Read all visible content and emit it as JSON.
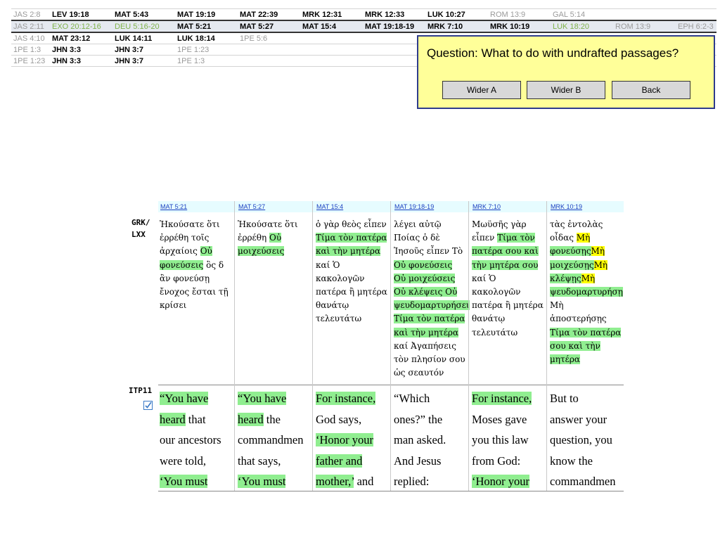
{
  "passages": {
    "rows": [
      {
        "selected": false,
        "cells": [
          {
            "text": "JAS 2:8",
            "style": "grey"
          },
          {
            "text": "LEV 19:18",
            "style": "bold"
          },
          {
            "text": "MAT 5:43",
            "style": "bold"
          },
          {
            "text": "MAT 19:19",
            "style": "bold"
          },
          {
            "text": "MAT 22:39",
            "style": "bold"
          },
          {
            "text": "MRK 12:31",
            "style": "bold"
          },
          {
            "text": "MRK 12:33",
            "style": "bold"
          },
          {
            "text": "LUK 10:27",
            "style": "bold"
          },
          {
            "text": "ROM 13:9",
            "style": "grey"
          },
          {
            "text": "GAL 5:14",
            "style": "grey"
          },
          {
            "text": "",
            "style": "grey"
          },
          {
            "text": "",
            "style": "grey"
          }
        ]
      },
      {
        "selected": true,
        "cells": [
          {
            "text": "JAS 2:11",
            "style": "grey"
          },
          {
            "text": "EXO 20:12-16",
            "style": "green"
          },
          {
            "text": "DEU 5:16-20",
            "style": "green"
          },
          {
            "text": "MAT 5:21",
            "style": "bold"
          },
          {
            "text": "MAT 5:27",
            "style": "bold"
          },
          {
            "text": "MAT 15:4",
            "style": "bold"
          },
          {
            "text": "MAT 19:18-19",
            "style": "bold"
          },
          {
            "text": "MRK 7:10",
            "style": "bold"
          },
          {
            "text": "MRK 10:19",
            "style": "bold"
          },
          {
            "text": "LUK 18:20",
            "style": "green"
          },
          {
            "text": "ROM 13:9",
            "style": "grey"
          },
          {
            "text": "EPH 6:2-3",
            "style": "grey"
          }
        ]
      },
      {
        "selected": false,
        "cells": [
          {
            "text": "JAS 4:10",
            "style": "grey"
          },
          {
            "text": "MAT 23:12",
            "style": "bold"
          },
          {
            "text": "LUK 14:11",
            "style": "bold"
          },
          {
            "text": "LUK 18:14",
            "style": "bold"
          },
          {
            "text": "1PE 5:6",
            "style": "grey"
          },
          {
            "text": "",
            "style": "grey"
          },
          {
            "text": "",
            "style": "grey"
          },
          {
            "text": "",
            "style": "grey"
          },
          {
            "text": "",
            "style": "grey"
          },
          {
            "text": "",
            "style": "grey"
          },
          {
            "text": "",
            "style": "grey"
          },
          {
            "text": "",
            "style": "grey"
          }
        ]
      },
      {
        "selected": false,
        "cells": [
          {
            "text": "1PE 1:3",
            "style": "grey"
          },
          {
            "text": "JHN 3:3",
            "style": "bold"
          },
          {
            "text": "JHN 3:7",
            "style": "bold"
          },
          {
            "text": "1PE 1:23",
            "style": "grey"
          },
          {
            "text": "",
            "style": "grey"
          },
          {
            "text": "",
            "style": "grey"
          },
          {
            "text": "",
            "style": "grey"
          },
          {
            "text": "",
            "style": "grey"
          },
          {
            "text": "",
            "style": "grey"
          },
          {
            "text": "",
            "style": "grey"
          },
          {
            "text": "",
            "style": "grey"
          },
          {
            "text": "",
            "style": "grey"
          }
        ]
      },
      {
        "selected": false,
        "cells": [
          {
            "text": "1PE 1:23",
            "style": "grey"
          },
          {
            "text": "JHN 3:3",
            "style": "bold"
          },
          {
            "text": "JHN 3:7",
            "style": "bold"
          },
          {
            "text": "1PE 1:3",
            "style": "grey"
          },
          {
            "text": "",
            "style": "grey"
          },
          {
            "text": "",
            "style": "grey"
          },
          {
            "text": "",
            "style": "grey"
          },
          {
            "text": "",
            "style": "grey"
          },
          {
            "text": "",
            "style": "grey"
          },
          {
            "text": "",
            "style": "grey"
          },
          {
            "text": "",
            "style": "grey"
          },
          {
            "text": "",
            "style": "grey"
          }
        ]
      }
    ]
  },
  "dialog": {
    "question": "Question: What to do with undrafted passages?",
    "wider_a": "Wider A",
    "wider_b": "Wider B",
    "back": "Back"
  },
  "labels": {
    "grk_line1": "GRK/",
    "grk_line2": "LXX",
    "itp": "ITP11",
    "checkbox_icon": "checkbox-checked-icon"
  },
  "highlight_colors": {
    "green": "#90ee90",
    "yellow": "#ffff00"
  },
  "columns": [
    {
      "ref": "MAT 5:21",
      "greek": [
        [
          "Ἠκούσατε ὅτι",
          ""
        ],
        [
          "ἐρρέθη τοῖς",
          ""
        ],
        [
          "ἀρχαίοις ",
          "Οὐ",
          "g"
        ],
        [
          "φονεύσεις",
          "g",
          " ὃς δ"
        ],
        [
          "ἂν φονεύσῃ",
          ""
        ],
        [
          "ἔνοχος ἔσται τῇ",
          ""
        ],
        [
          "κρίσει",
          ""
        ]
      ],
      "english": [
        [
          "“You have",
          "g"
        ],
        [
          "heard",
          "g",
          " that"
        ],
        [
          "our ancestors",
          ""
        ],
        [
          "were told,",
          ""
        ],
        [
          "‘You must",
          "g"
        ]
      ]
    },
    {
      "ref": "MAT 5:27",
      "greek": [
        [
          "Ἠκούσατε ὅτι",
          ""
        ],
        [
          "ἐρρέθη ",
          "Οὐ",
          "g"
        ],
        [
          "μοιχεύσεις",
          "g"
        ]
      ],
      "english": [
        [
          "“You have",
          "g"
        ],
        [
          "heard",
          "g",
          " the"
        ],
        [
          "commandmen",
          ""
        ],
        [
          "that says,",
          ""
        ],
        [
          "‘You must",
          "g"
        ]
      ]
    },
    {
      "ref": "MAT 15:4",
      "greek": [
        [
          "ὁ γὰρ θεὸς εἶπεν",
          ""
        ],
        [
          "Τίμα τὸν πατέρα",
          "g"
        ],
        [
          "καὶ τὴν μητέρα",
          "g"
        ],
        [
          "καί Ὁ",
          ""
        ],
        [
          "κακολογῶν",
          ""
        ],
        [
          "πατέρα ἢ μητέρα",
          ""
        ],
        [
          "θανάτῳ",
          ""
        ],
        [
          "τελευτάτω",
          ""
        ]
      ],
      "english": [
        [
          "For instance,",
          "g"
        ],
        [
          "God says,",
          ""
        ],
        [
          "‘Honor your",
          "g"
        ],
        [
          "father and",
          "g"
        ],
        [
          "mother,’",
          "g",
          " and"
        ]
      ]
    },
    {
      "ref": "MAT 19:18-19",
      "greek": [
        [
          "λέγει αὐτῷ",
          ""
        ],
        [
          "Ποίας ὁ δὲ",
          ""
        ],
        [
          "Ἰησοῦς εἶπεν Τὸ",
          ""
        ],
        [
          "Οὐ φονεύσεις",
          "g"
        ],
        [
          "Οὐ μοιχεύσεις",
          "g"
        ],
        [
          "Οὐ κλέψεις Οὐ",
          "g"
        ],
        [
          "ψευδομαρτυρήσει",
          "g"
        ],
        [
          "Τίμα τὸν πατέρα",
          "g"
        ],
        [
          "καὶ τὴν μητέρα",
          "g"
        ],
        [
          "καί Ἀγαπήσεις",
          ""
        ],
        [
          "τὸν πλησίον σου",
          ""
        ],
        [
          "ὡς σεαυτόν",
          ""
        ]
      ],
      "english": [
        [
          "“Which",
          ""
        ],
        [
          "ones?” the",
          ""
        ],
        [
          "man asked.",
          ""
        ],
        [
          "And Jesus",
          ""
        ],
        [
          "replied:",
          ""
        ]
      ]
    },
    {
      "ref": "MRK 7:10",
      "greek": [
        [
          "Μωϋσῆς γὰρ",
          ""
        ],
        [
          "εἶπεν ",
          "Τίμα τὸν",
          "g"
        ],
        [
          "πατέρα σου καὶ",
          "g"
        ],
        [
          "τὴν μητέρα σου",
          "g"
        ],
        [
          "καί Ὁ",
          ""
        ],
        [
          "κακολογῶν",
          ""
        ],
        [
          "πατέρα ἢ μητέρα",
          ""
        ],
        [
          "θανάτῳ",
          ""
        ],
        [
          "τελευτάτω",
          ""
        ]
      ],
      "english": [
        [
          "For instance,",
          "g"
        ],
        [
          "Moses gave",
          ""
        ],
        [
          "you this law",
          ""
        ],
        [
          "from God:",
          ""
        ],
        [
          "‘Honor your",
          "g"
        ]
      ]
    },
    {
      "ref": "MRK 10:19",
      "greek": [
        [
          "τὰς ἐντολὰς",
          ""
        ],
        [
          "οἶδας ",
          "Μὴ",
          "y"
        ],
        [
          "φονεύσῃς",
          "g",
          "Μὴ",
          "y"
        ],
        [
          "μοιχεύσῃς",
          "g",
          "Μὴ",
          "y"
        ],
        [
          "κλέψῃς",
          "g",
          "Μὴ",
          "y"
        ],
        [
          "ψευδομαρτυρήσῃ",
          "g"
        ],
        [
          "Μὴ",
          ""
        ],
        [
          "ἀποστερήσῃς",
          ""
        ],
        [
          "Τίμα τὸν πατέρα",
          "g"
        ],
        [
          "σου καὶ τὴν",
          "g"
        ],
        [
          "μητέρα",
          "g"
        ]
      ],
      "english": [
        [
          "But to",
          ""
        ],
        [
          "answer your",
          ""
        ],
        [
          "question, you",
          ""
        ],
        [
          "know the",
          ""
        ],
        [
          "commandmen",
          ""
        ]
      ]
    }
  ]
}
